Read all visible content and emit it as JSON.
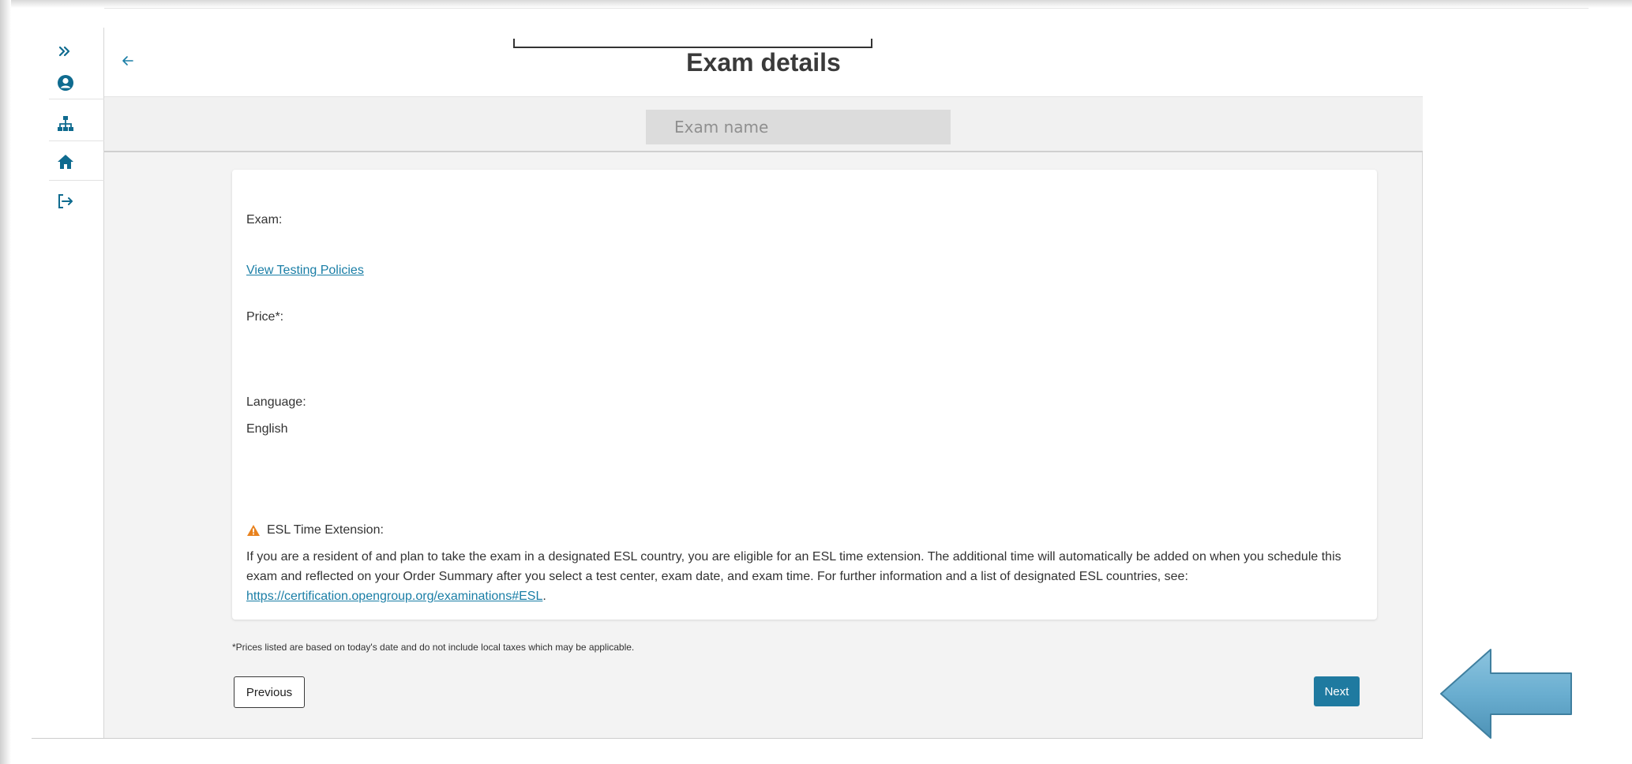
{
  "header": {
    "title": "Exam details"
  },
  "exam_name": {
    "placeholder": "Exam name"
  },
  "rail": {
    "items": [
      {
        "icon": "double-chevron-right-icon"
      },
      {
        "icon": "user-circle-icon"
      },
      {
        "icon": "sitemap-icon"
      },
      {
        "icon": "home-icon"
      },
      {
        "icon": "sign-out-icon"
      }
    ]
  },
  "details": {
    "exam_label": "Exam:",
    "policies_link": "View Testing Policies",
    "price_label": "Price*:",
    "language_label": "Language:",
    "language_value": "English",
    "esl_heading": "ESL Time Extension:",
    "esl_text": "If you are a resident of and plan to take the exam in a designated ESL country, you are eligible for an ESL time extension. The additional time will automatically be added on when you schedule this exam and reflected on your Order Summary after you select a test center, exam date, and exam time. For further information and a list of designated ESL countries, see: ",
    "esl_link": "https://certification.opengroup.org/examinations#ESL",
    "esl_end": "."
  },
  "footnote": "*Prices listed are based on today's date and do not include local taxes which may be applicable.",
  "buttons": {
    "previous": "Previous",
    "next": "Next"
  },
  "colors": {
    "accent": "#1f7aa0",
    "link": "#1a7ea6",
    "warning": "#e8821e",
    "callout": "#6aaed0"
  }
}
